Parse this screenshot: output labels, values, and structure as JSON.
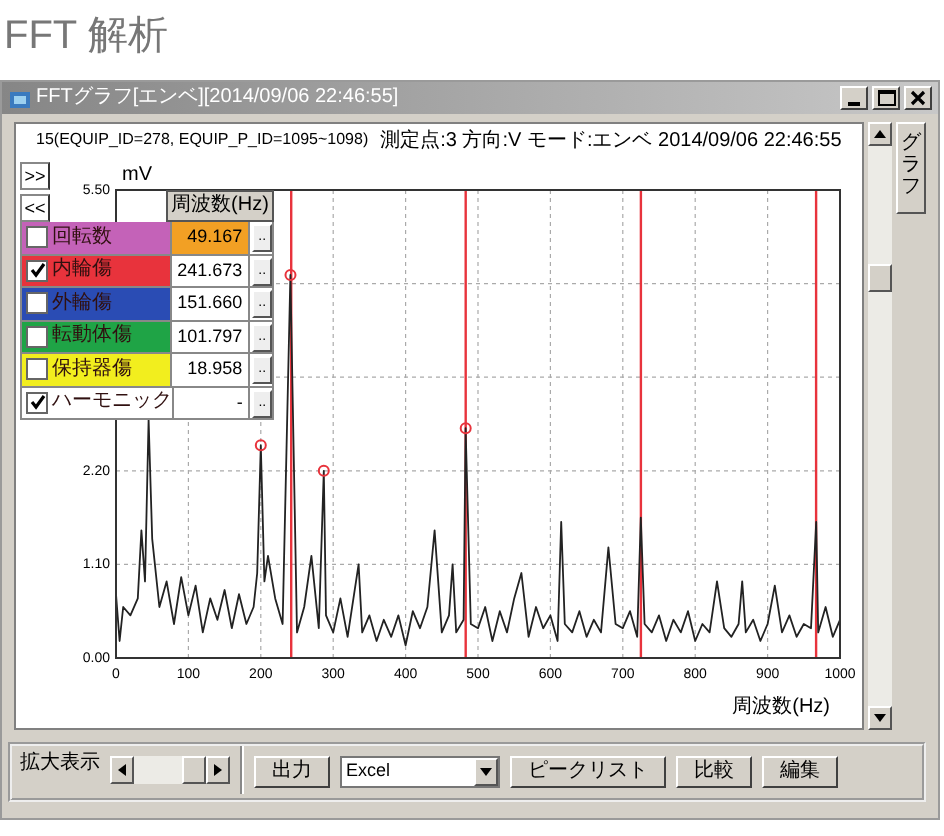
{
  "heading": "FFT 解析",
  "window": {
    "title": "FFTグラフ[エンベ][2014/09/06 22:46:55]",
    "tab": "グラフ"
  },
  "chart_header": {
    "equipment": "15(EQUIP_ID=278, EQUIP_P_ID=1095~1098)",
    "measurement": "測定点:3 方向:V モード:エンベ 2014/09/06 22:46:55"
  },
  "panel_buttons": [
    ">>",
    "<<"
  ],
  "legend": {
    "header": "周波数(Hz)",
    "rows": [
      {
        "label": "回転数",
        "value": "49.167",
        "checked": false,
        "selected": true,
        "color": "#c462b8",
        "button": ".."
      },
      {
        "label": "内輪傷",
        "value": "241.673",
        "checked": true,
        "selected": false,
        "color": "#e8333c",
        "button": ".."
      },
      {
        "label": "外輪傷",
        "value": "151.660",
        "checked": false,
        "selected": false,
        "color": "#2a4cb4",
        "button": ".."
      },
      {
        "label": "転動体傷",
        "value": "101.797",
        "checked": false,
        "selected": false,
        "color": "#1fa446",
        "button": ".."
      },
      {
        "label": "保持器傷",
        "value": "18.958",
        "checked": false,
        "selected": false,
        "color": "#f2ee1e",
        "button": ".."
      },
      {
        "label": "ハーモニック",
        "value": "-",
        "checked": true,
        "selected": false,
        "button": ".."
      }
    ]
  },
  "chart_data": {
    "type": "line",
    "xlabel": "周波数(Hz)",
    "ylabel": "mV",
    "xlim": [
      0,
      1000
    ],
    "ylim": [
      0,
      5.5
    ],
    "xticks": [
      0,
      100,
      200,
      300,
      400,
      500,
      600,
      700,
      800,
      900,
      1000
    ],
    "yticks": [
      {
        "value": 0,
        "label": "0.00"
      },
      {
        "value": 1.1,
        "label": "1.10"
      },
      {
        "value": 2.2,
        "label": "2.20"
      },
      {
        "value": 5.5,
        "label": "5.50"
      }
    ],
    "x": [
      0,
      5,
      10,
      20,
      30,
      35,
      40,
      45,
      50,
      60,
      70,
      80,
      90,
      100,
      110,
      120,
      130,
      140,
      150,
      160,
      170,
      180,
      190,
      195,
      200,
      205,
      210,
      220,
      230,
      241,
      250,
      260,
      270,
      280,
      287,
      290,
      300,
      310,
      320,
      335,
      340,
      350,
      360,
      370,
      380,
      390,
      400,
      410,
      420,
      430,
      440,
      450,
      460,
      465,
      470,
      480,
      483,
      490,
      500,
      510,
      520,
      530,
      540,
      550,
      560,
      570,
      580,
      590,
      600,
      610,
      615,
      620,
      630,
      640,
      650,
      660,
      670,
      680,
      690,
      700,
      710,
      720,
      725,
      730,
      740,
      750,
      760,
      770,
      780,
      790,
      800,
      810,
      820,
      830,
      840,
      850,
      860,
      865,
      870,
      880,
      890,
      900,
      910,
      920,
      930,
      940,
      950,
      960,
      967,
      970,
      980,
      990,
      1000
    ],
    "grid": true,
    "series": [
      {
        "color": "#222222",
        "values": [
          0.75,
          0.2,
          0.6,
          0.5,
          0.7,
          1.5,
          0.9,
          2.8,
          1.4,
          0.6,
          0.9,
          0.4,
          0.95,
          0.5,
          0.85,
          0.3,
          0.7,
          0.45,
          0.8,
          0.35,
          0.75,
          0.4,
          0.6,
          1.0,
          2.5,
          0.9,
          1.2,
          0.7,
          0.4,
          4.5,
          0.3,
          0.6,
          1.2,
          0.35,
          2.2,
          0.5,
          0.3,
          0.7,
          0.25,
          1.1,
          0.3,
          0.5,
          0.2,
          0.45,
          0.25,
          0.5,
          0.15,
          0.55,
          0.35,
          0.6,
          1.5,
          0.3,
          0.5,
          1.1,
          0.3,
          0.45,
          2.7,
          0.4,
          0.35,
          0.6,
          0.2,
          0.55,
          0.3,
          0.7,
          1.0,
          0.25,
          0.6,
          0.35,
          0.5,
          0.2,
          1.6,
          0.4,
          0.3,
          0.55,
          0.25,
          0.45,
          0.3,
          1.3,
          0.4,
          0.35,
          0.55,
          0.25,
          1.65,
          0.4,
          0.3,
          0.5,
          0.2,
          0.45,
          0.3,
          0.55,
          0.2,
          0.4,
          0.3,
          0.9,
          0.35,
          0.25,
          0.4,
          0.9,
          0.3,
          0.45,
          0.2,
          0.4,
          0.85,
          0.3,
          0.5,
          0.25,
          0.4,
          0.35,
          1.6,
          0.3,
          0.6,
          0.25,
          0.45
        ]
      },
      {
        "color": "#e8333c",
        "marker": "circle",
        "values": [
          null,
          null,
          null,
          null,
          null,
          null,
          null,
          null,
          null,
          null,
          null,
          null,
          null,
          null,
          null,
          null,
          null,
          null,
          null,
          null,
          null,
          null,
          null,
          null,
          2.5,
          null,
          null,
          null,
          null,
          4.5,
          null,
          null,
          null,
          null,
          2.2,
          null,
          null,
          null,
          null,
          null,
          null,
          null,
          null,
          null,
          null,
          null,
          null,
          null,
          null,
          null,
          null,
          null,
          null,
          null,
          null,
          null,
          2.7,
          null,
          null,
          null,
          null,
          null,
          null,
          null,
          null,
          null,
          null,
          null,
          null,
          null,
          null,
          null,
          null,
          null,
          null,
          null,
          null,
          null,
          null,
          null,
          null,
          null,
          null,
          null,
          null,
          null,
          null,
          null,
          null,
          null,
          null,
          null,
          null,
          null,
          null,
          null,
          null,
          null,
          null,
          null,
          null,
          null,
          null,
          null,
          null,
          null,
          null,
          null,
          null,
          null,
          null,
          null,
          null
        ]
      }
    ],
    "ref_lines": [
      {
        "axis": "x",
        "value": 242,
        "color": "#e8333c"
      },
      {
        "axis": "x",
        "value": 483,
        "color": "#e8333c"
      },
      {
        "axis": "x",
        "value": 725,
        "color": "#e8333c"
      },
      {
        "axis": "x",
        "value": 967,
        "color": "#e8333c"
      }
    ]
  },
  "toolbar": {
    "zoom_label": "拡大表示",
    "items": [
      {
        "kind": "button",
        "label": "出力"
      },
      {
        "kind": "select",
        "value": "Excel"
      },
      {
        "kind": "button",
        "label": "ピークリスト"
      },
      {
        "kind": "button",
        "label": "比較"
      },
      {
        "kind": "button",
        "label": "編集"
      }
    ]
  }
}
